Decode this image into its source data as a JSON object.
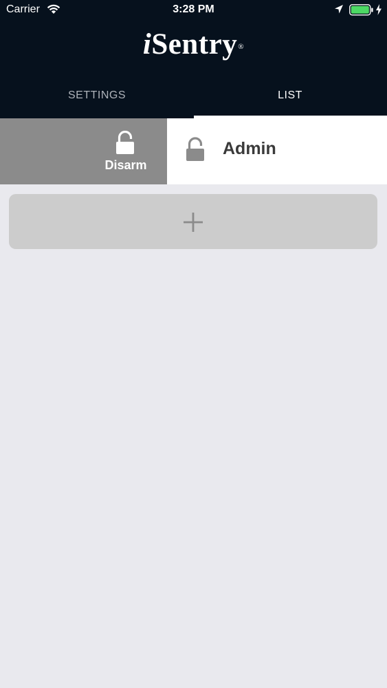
{
  "status_bar": {
    "carrier": "Carrier",
    "time": "3:28 PM",
    "icons": [
      "wifi-icon",
      "location-arrow-icon",
      "battery-icon",
      "charging-bolt-icon"
    ],
    "battery_color": "#4cd964"
  },
  "header": {
    "logo_i": "i",
    "logo_rest": "Sentry",
    "logo_mark": "®",
    "background": "#06111d"
  },
  "tabs": [
    {
      "label": "SETTINGS",
      "selected": false
    },
    {
      "label": "LIST",
      "selected": true
    }
  ],
  "list": {
    "items": [
      {
        "name": "Admin",
        "icon": "unlocked-padlock-icon",
        "swipe_action": {
          "label": "Disarm",
          "icon": "unlocked-padlock-icon",
          "color": "#8b8b8b"
        }
      }
    ]
  },
  "add_button": {
    "icon": "plus-icon"
  }
}
